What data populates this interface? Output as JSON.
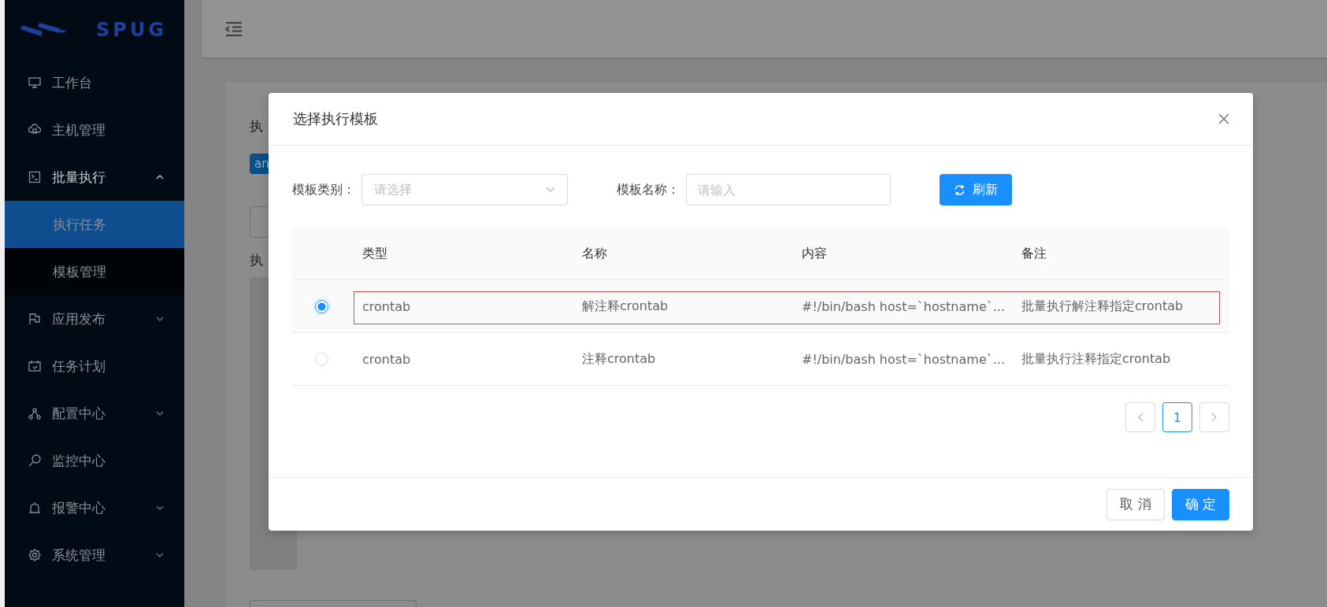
{
  "sidebar": {
    "logo": "SPUG",
    "items": [
      {
        "label": "工作台",
        "selected": false
      },
      {
        "label": "主机管理",
        "selected": false
      },
      {
        "label": "批量执行",
        "selected": false,
        "expanded": true,
        "children": [
          {
            "label": "执行任务",
            "selected": true
          },
          {
            "label": "模板管理",
            "selected": false
          }
        ]
      },
      {
        "label": "应用发布",
        "selected": false,
        "expanded": false
      },
      {
        "label": "任务计划",
        "selected": false
      },
      {
        "label": "配置中心",
        "selected": false,
        "expanded": false
      },
      {
        "label": "监控中心",
        "selected": false
      },
      {
        "label": "报警中心",
        "selected": false,
        "expanded": false
      },
      {
        "label": "系统管理",
        "selected": false,
        "expanded": false
      }
    ]
  },
  "page_behind": {
    "heading": "执",
    "tag": "an",
    "label": "执"
  },
  "modal": {
    "title": "选择执行模板",
    "filters": [
      {
        "kind": "select",
        "label": "模板类别：",
        "placeholder": "请选择"
      },
      {
        "kind": "input",
        "label": "模板名称：",
        "placeholder": "请输入"
      }
    ],
    "refresh_button": "刷新",
    "table": {
      "columns": [
        "类型",
        "名称",
        "内容",
        "备注"
      ],
      "rows": [
        {
          "selected": true,
          "outlined": true,
          "cells": [
            "crontab",
            "解注释crontab",
            "#!/bin/bash host=`hostname`...",
            "批量执行解注释指定crontab"
          ]
        },
        {
          "selected": false,
          "outlined": false,
          "cells": [
            "crontab",
            "注释crontab",
            "#!/bin/bash host=`hostname`...",
            "批量执行注释指定crontab"
          ]
        }
      ]
    },
    "pagination": [
      {
        "label": "1",
        "selected": true
      }
    ],
    "buttons": [
      {
        "kind": "default",
        "label": "取 消"
      },
      {
        "kind": "primary",
        "label": "确 定"
      }
    ]
  }
}
